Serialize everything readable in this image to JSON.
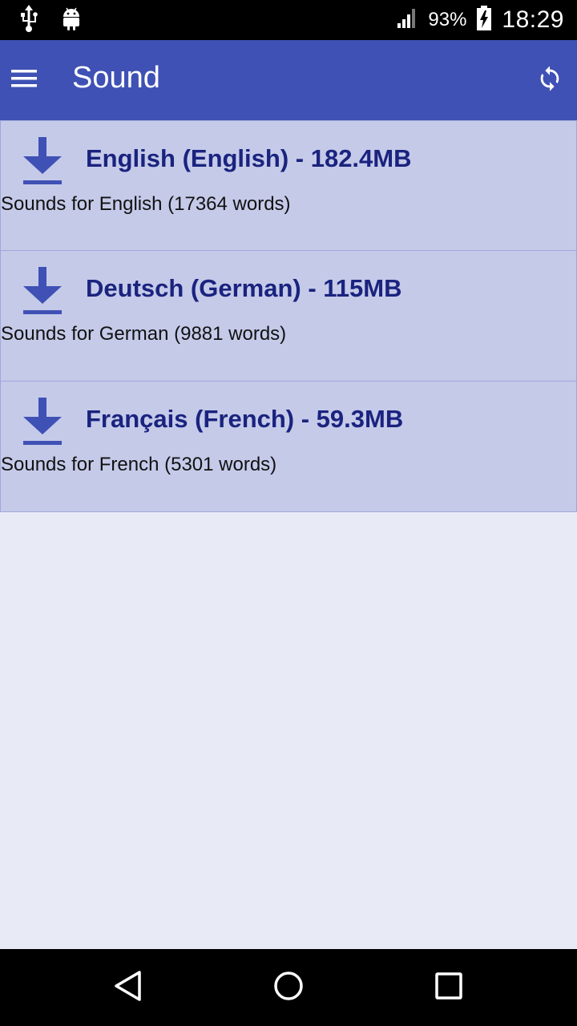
{
  "status_bar": {
    "icons": [
      "usb-icon",
      "android-icon",
      "signal-icon",
      "battery-charging-icon"
    ],
    "battery": "93%",
    "time": "18:29"
  },
  "app_bar": {
    "title": "Sound",
    "menu_icon": "hamburger-menu-icon",
    "action_icon": "sync-icon"
  },
  "sounds": [
    {
      "title": "English (English) - 182.4MB",
      "subtitle": "Sounds for English (17364 words)",
      "icon": "download-icon"
    },
    {
      "title": "Deutsch (German) - 115MB",
      "subtitle": "Sounds for German (9881 words)",
      "icon": "download-icon"
    },
    {
      "title": "Français (French) - 59.3MB",
      "subtitle": "Sounds for French (5301 words)",
      "icon": "download-icon"
    }
  ],
  "nav_bar": {
    "icons": [
      "back-icon",
      "home-icon",
      "recents-icon"
    ]
  },
  "colors": {
    "primary": "#3f51b5",
    "item_bg": "#c5cae9",
    "page_bg": "#e8eaf6",
    "title_text": "#1a237e"
  }
}
